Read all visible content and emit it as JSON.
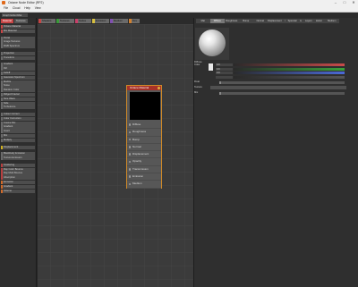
{
  "window": {
    "title": "Octane Node Editor (RP2)",
    "min": "–",
    "max": "□",
    "close": "✕"
  },
  "menu": [
    "File",
    "Cloud",
    "Help",
    "View"
  ],
  "toolbar": {
    "path": "Graph Editor/Mat"
  },
  "left_tabs": [
    "Material",
    "Textures"
  ],
  "node_list": [
    {
      "label": "Octane Material",
      "color": "#c64545"
    },
    {
      "label": "Mix Material",
      "color": "#c64545"
    },
    {
      "gap": true
    },
    {
      "label": "Portal",
      "color": "#6a6a6a"
    },
    {
      "label": "Image Textures",
      "color": "#6a6a6a"
    },
    {
      "label": "RGB Spectrum",
      "color": "#6a6a6a"
    },
    {
      "gap": true
    },
    {
      "label": "Projection",
      "color": "#6a6a6a"
    },
    {
      "label": "Transform",
      "color": "#6a6a6a"
    },
    {
      "gap": true
    },
    {
      "label": "Gradient",
      "color": "#6a6a6a"
    },
    {
      "label": "Dirt",
      "color": "#6a6a6a"
    },
    {
      "label": "Falloff",
      "color": "#6a6a6a"
    },
    {
      "label": "Gaussian Spectrum",
      "color": "#6a6a6a"
    },
    {
      "label": "Marble",
      "color": "#6a6a6a"
    },
    {
      "label": "Noise",
      "color": "#6a6a6a"
    },
    {
      "label": "Random Color",
      "color": "#6a6a6a"
    },
    {
      "label": "Ridged Fractal",
      "color": "#6a6a6a"
    },
    {
      "label": "Sine Wave",
      "color": "#6a6a6a"
    },
    {
      "label": "Side",
      "color": "#6a6a6a"
    },
    {
      "label": "Turbulence",
      "color": "#6a6a6a"
    },
    {
      "gap": true
    },
    {
      "label": "Colour Correct",
      "color": "#6a6a6a"
    },
    {
      "label": "Color Correction",
      "color": "#6a6a6a"
    },
    {
      "label": "Cosine Mix",
      "color": "#6a6a6a"
    },
    {
      "label": "Gradient",
      "color": "#6a6a6a"
    },
    {
      "label": "Invert",
      "color": "#6a6a6a"
    },
    {
      "label": "Mix",
      "color": "#6a6a6a"
    },
    {
      "label": "Multiply",
      "color": "#6a6a6a"
    },
    {
      "gap": true
    },
    {
      "label": "Displacement",
      "color": "#d0b020"
    },
    {
      "gap": true
    },
    {
      "label": "Blackbody Emission",
      "color": "#6a6a6a"
    },
    {
      "label": "Texture Emission",
      "color": "#6a6a6a"
    },
    {
      "gap": true
    },
    {
      "label": "Scattering",
      "color": "#b84040"
    },
    {
      "label": "Ray Color Bounce",
      "color": "#b84040"
    },
    {
      "label": "Ray Multi Bounce",
      "color": "#b84040"
    },
    {
      "label": "Absorption",
      "color": "#b84040"
    },
    {
      "label": "Emission",
      "color": "#d06a2a"
    },
    {
      "label": "Gradient",
      "color": "#d06a2a"
    },
    {
      "label": "Volume",
      "color": "#d06a2a"
    }
  ],
  "graph_tabs": [
    {
      "label": "Shaders",
      "color": "#c64545"
    },
    {
      "label": "Textures",
      "color": "#3a9a3a"
    },
    {
      "label": "Nodes",
      "color": "#c8406a"
    },
    {
      "label": "Emission",
      "color": "#d8c040"
    },
    {
      "label": "Medium",
      "color": "#8050b0"
    },
    {
      "label": "Dev",
      "color": "#d08030"
    }
  ],
  "node": {
    "title": "Octane Material",
    "inputs": [
      "Diffuse",
      "Roughness",
      "Bump",
      "Normal",
      "Displacement",
      "Opacity",
      "Transmission",
      "Emission",
      "Medium"
    ]
  },
  "right_tabs": [
    "Mat",
    "Diffuse",
    "Roughness",
    "Bump",
    "Normal",
    "Displacement",
    "Opacity",
    "Transmission",
    "Emission",
    "Medium",
    "Specular",
    "Layers"
  ],
  "inspector": {
    "section": "Diffuse",
    "params": [
      {
        "label": "Color",
        "value": "0.9",
        "color": "#c94a4a"
      },
      {
        "label": "",
        "value": "0.9",
        "color": "#3aa23a"
      },
      {
        "label": "",
        "value": "0.9",
        "color": "#4a6ad8"
      },
      {
        "label": "",
        "value": "",
        "color": "#555555"
      }
    ],
    "float_label": "Float",
    "texture_label": "Texture",
    "mix_label": "Mix"
  }
}
